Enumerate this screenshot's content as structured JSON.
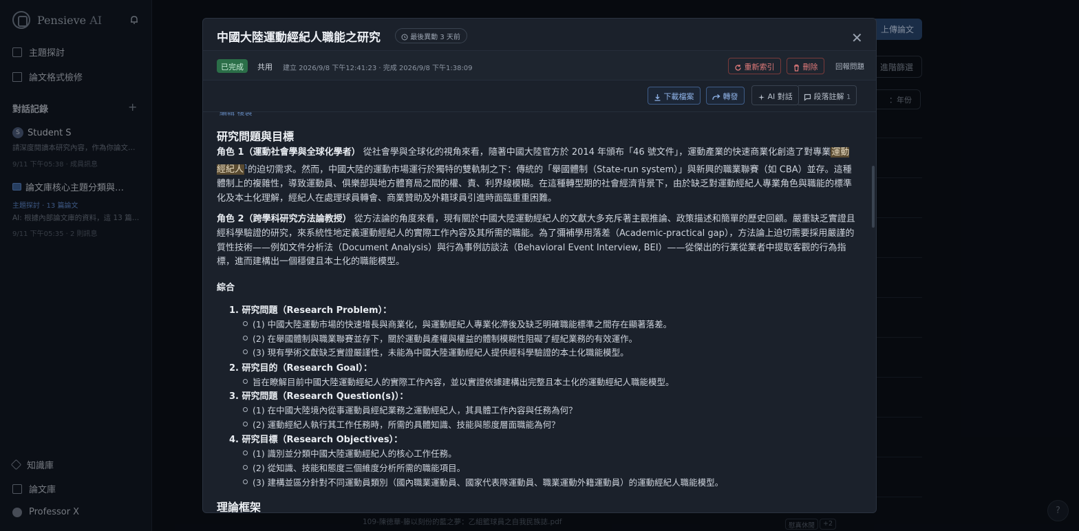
{
  "sidebar": {
    "brand": "Pensieve",
    "brand_ai": "AI",
    "nav": [
      {
        "label": "主題探討"
      },
      {
        "label": "論文格式檢修"
      }
    ],
    "history_title": "對話記錄",
    "conversations": [
      {
        "avatar": "S",
        "title": "Student S",
        "preview": "請深度閱讀本研究內容，作為你論文…",
        "meta": "9/11 下午05:38 · 成員訊息"
      },
      {
        "title": "論文庫核心主題分類與…",
        "tag": "主題探討 · 13 篇論文",
        "preview": "AI: 根據內部論文庫的資料，這 13 篇…",
        "meta": "9/11 下午05:35 · 2 則訊息"
      }
    ],
    "bottom": [
      {
        "label": "知識庫"
      },
      {
        "label": "論文庫"
      },
      {
        "label": "Professor X"
      }
    ]
  },
  "background": {
    "upload": "上傳論文",
    "filter": "進階篩選",
    "sort": "：年份",
    "file": "109-陳徳華-籐以刻份的藍之夢：乙組籃球員之自我民族誌.pdf",
    "badges": [
      "慰真休閒",
      "+2"
    ]
  },
  "modal": {
    "title": "中國大陸運動經紀人職能之研究",
    "time": "最後異動 3 天前",
    "status": "已完成",
    "share": "共用",
    "dates": "建立 2026/9/8 下午12:41:23 · 完成 2026/9/8 下午1:38:09",
    "reindex": "重新索引",
    "delete": "刪除",
    "report": "回報問題",
    "download": "下載檔案",
    "forward": "轉發",
    "ai_chat": "AI 對話",
    "annotation": "段落註解",
    "annotation_count": "1",
    "cut_text": "編輯   複製",
    "section1": "研究問題與目標",
    "para1_bold": "角色 1（運動社會學與全球化學者）",
    "para1_a": " 從社會學與全球化的視角來看，隨著中國大陸官方於 2014 年頒布「46 號文件」，運動產業的快速商業化創造了對專業",
    "para1_hl": "運動經紀人",
    "para1_sup": "1",
    "para1_b": "的迫切需求。然而，中國大陸的運動市場運行於獨特的雙軌制之下：傳統的「舉國體制（State-run system）」與新興的職業聯賽（如 CBA）並存。這種體制上的複雜性，導致運動員、俱樂部與地方體育局之間的權、責、利界線模糊。在這種轉型期的社會經濟背景下，由於缺乏對運動經紀人專業角色與職能的標準化及本土化理解，經紀人在處理球員轉會、商業贊助及外籍球員引進時面臨重重困難。",
    "para2_bold": "角色 2（跨學科研究方法論教授）",
    "para2_text": " 從方法論的角度來看，現有關於中國大陸運動經紀人的文獻大多充斥著主觀推論、政策描述和簡單的歷史回顧。嚴重缺乏實證且經科學驗證的研究，來系統性地定義運動經紀人的實際工作內容及其所需的職能。為了彌補學用落差（Academic-practical gap），方法論上迫切需要採用嚴謹的質性技術——例如文件分析法（Document Analysis）與行為事例訪談法（Behavioral Event Interview, BEI）——從傑出的行業從業者中提取客觀的行為指標，進而建構出一個穩健且本土化的職能模型。",
    "summary": "綜合",
    "list": [
      {
        "num": "1.",
        "title": "研究問題（Research Problem）：",
        "items": [
          "(1) 中國大陸運動市場的快速增長與商業化，與運動經紀人專業化滯後及缺乏明確職能標準之間存在顯著落差。",
          "(2) 在舉國體制與職業聯賽並存下，關於運動員產權與權益的體制模糊性阻礙了經紀業務的有效運作。",
          "(3) 現有學術文獻缺乏實證嚴謹性，未能為中國大陸運動經紀人提供經科學驗證的本土化職能模型。"
        ]
      },
      {
        "num": "2.",
        "title": "研究目的（Research Goal）：",
        "items": [
          "旨在瞭解目前中國大陸運動經紀人的實際工作內容，並以實證依據建構出完整且本土化的運動經紀人職能模型。"
        ]
      },
      {
        "num": "3.",
        "title": "研究問題（Research Question(s)）：",
        "items": [
          "(1) 在中國大陸境內從事運動員經紀業務之運動經紀人，其具體工作內容與任務為何？",
          "(2) 運動經紀人執行其工作任務時，所需的具體知識、技能與態度層面職能為何？"
        ]
      },
      {
        "num": "4.",
        "title": "研究目標（Research Objectives）：",
        "items": [
          "(1) 識別並分類中國大陸運動經紀人的核心工作任務。",
          "(2) 從知識、技能和態度三個維度分析所需的職能項目。",
          "(3) 建構並區分針對不同運動員類別（國內職業運動員、國家代表隊運動員、職業運動外籍運動員）的運動經紀人職能模型。"
        ]
      }
    ],
    "section2": "理論框架"
  }
}
